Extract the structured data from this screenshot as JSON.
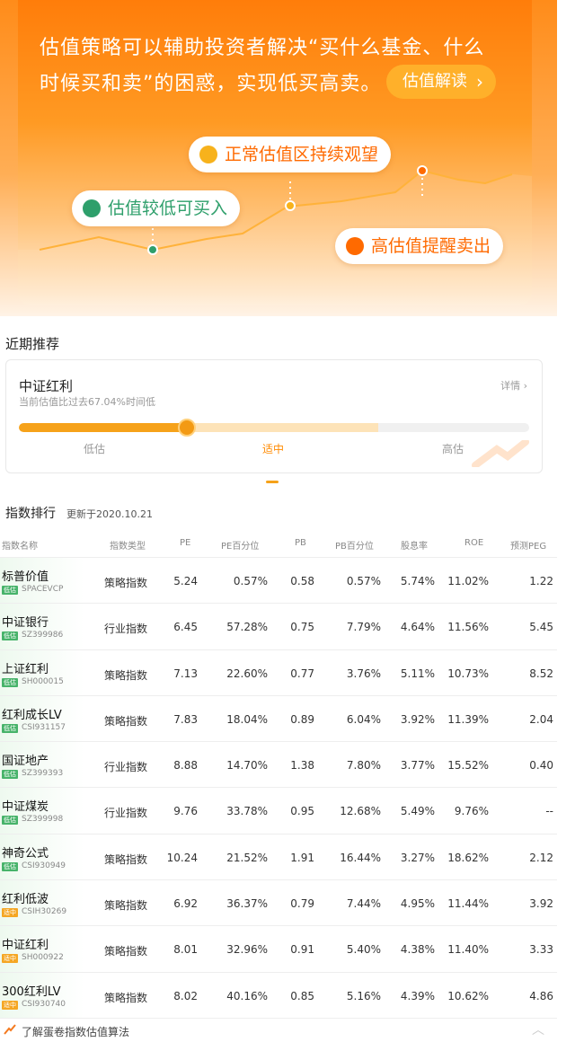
{
  "hero": {
    "line1": "估值策略可以辅助投资者解决“买什么基金、什么",
    "line2": "时候买和卖”的困惑，实现低买高卖。",
    "button": "估值解读",
    "pill_low": "估值较低可买入",
    "pill_mid": "正常估值区持续观望",
    "pill_high": "高估值提醒卖出",
    "colors": {
      "green": "#2e9f6b",
      "orange": "#ff6a00",
      "yellow": "#f7b21c"
    }
  },
  "recent": {
    "title": "近期推荐",
    "name": "中证红利",
    "desc": "当前估值比过去67.04%时间低",
    "percent": 67.04,
    "detail": "详情",
    "levels": [
      "低估",
      "适中",
      "高估"
    ]
  },
  "ranking": {
    "title": "指数排行",
    "updated": "更新于2020.10.21",
    "headers": [
      "指数名称",
      "指数类型",
      "PE",
      "PE百分位",
      "PB",
      "PB百分位",
      "股息率",
      "ROE",
      "预测PEG"
    ],
    "rows": [
      {
        "name": "标普价值",
        "tag": "低估",
        "code": "SPACEVCP",
        "type": "策略指数",
        "pe": "5.24",
        "pe_pct": "0.57%",
        "pb": "0.58",
        "pb_pct": "0.57%",
        "div": "5.74%",
        "roe": "11.02%",
        "peg": "1.22"
      },
      {
        "name": "中证银行",
        "tag": "低估",
        "code": "SZ399986",
        "type": "行业指数",
        "pe": "6.45",
        "pe_pct": "57.28%",
        "pb": "0.75",
        "pb_pct": "7.79%",
        "div": "4.64%",
        "roe": "11.56%",
        "peg": "5.45"
      },
      {
        "name": "上证红利",
        "tag": "低估",
        "code": "SH000015",
        "type": "策略指数",
        "pe": "7.13",
        "pe_pct": "22.60%",
        "pb": "0.77",
        "pb_pct": "3.76%",
        "div": "5.11%",
        "roe": "10.73%",
        "peg": "8.52"
      },
      {
        "name": "红利成长LV",
        "tag": "低估",
        "code": "CSI931157",
        "type": "策略指数",
        "pe": "7.83",
        "pe_pct": "18.04%",
        "pb": "0.89",
        "pb_pct": "6.04%",
        "div": "3.92%",
        "roe": "11.39%",
        "peg": "2.04"
      },
      {
        "name": "国证地产",
        "tag": "低估",
        "code": "SZ399393",
        "type": "行业指数",
        "pe": "8.88",
        "pe_pct": "14.70%",
        "pb": "1.38",
        "pb_pct": "7.80%",
        "div": "3.77%",
        "roe": "15.52%",
        "peg": "0.40"
      },
      {
        "name": "中证煤炭",
        "tag": "低估",
        "code": "SZ399998",
        "type": "行业指数",
        "pe": "9.76",
        "pe_pct": "33.78%",
        "pb": "0.95",
        "pb_pct": "12.68%",
        "div": "5.49%",
        "roe": "9.76%",
        "peg": "--"
      },
      {
        "name": "神奇公式",
        "tag": "低估",
        "code": "CSI930949",
        "type": "策略指数",
        "pe": "10.24",
        "pe_pct": "21.52%",
        "pb": "1.91",
        "pb_pct": "16.44%",
        "div": "3.27%",
        "roe": "18.62%",
        "peg": "2.12"
      },
      {
        "name": "红利低波",
        "tag": "适中",
        "code": "CSIH30269",
        "type": "策略指数",
        "pe": "6.92",
        "pe_pct": "36.37%",
        "pb": "0.79",
        "pb_pct": "7.44%",
        "div": "4.95%",
        "roe": "11.44%",
        "peg": "3.92"
      },
      {
        "name": "中证红利",
        "tag": "适中",
        "code": "SH000922",
        "type": "策略指数",
        "pe": "8.01",
        "pe_pct": "32.96%",
        "pb": "0.91",
        "pb_pct": "5.40%",
        "div": "4.38%",
        "roe": "11.40%",
        "peg": "3.33"
      },
      {
        "name": "300红利LV",
        "tag": "适中",
        "code": "CSI930740",
        "type": "策略指数",
        "pe": "8.02",
        "pe_pct": "40.16%",
        "pb": "0.85",
        "pb_pct": "5.16%",
        "div": "4.39%",
        "roe": "10.62%",
        "peg": "4.86"
      }
    ]
  },
  "footer": {
    "text": "了解蛋卷指数估值算法"
  }
}
